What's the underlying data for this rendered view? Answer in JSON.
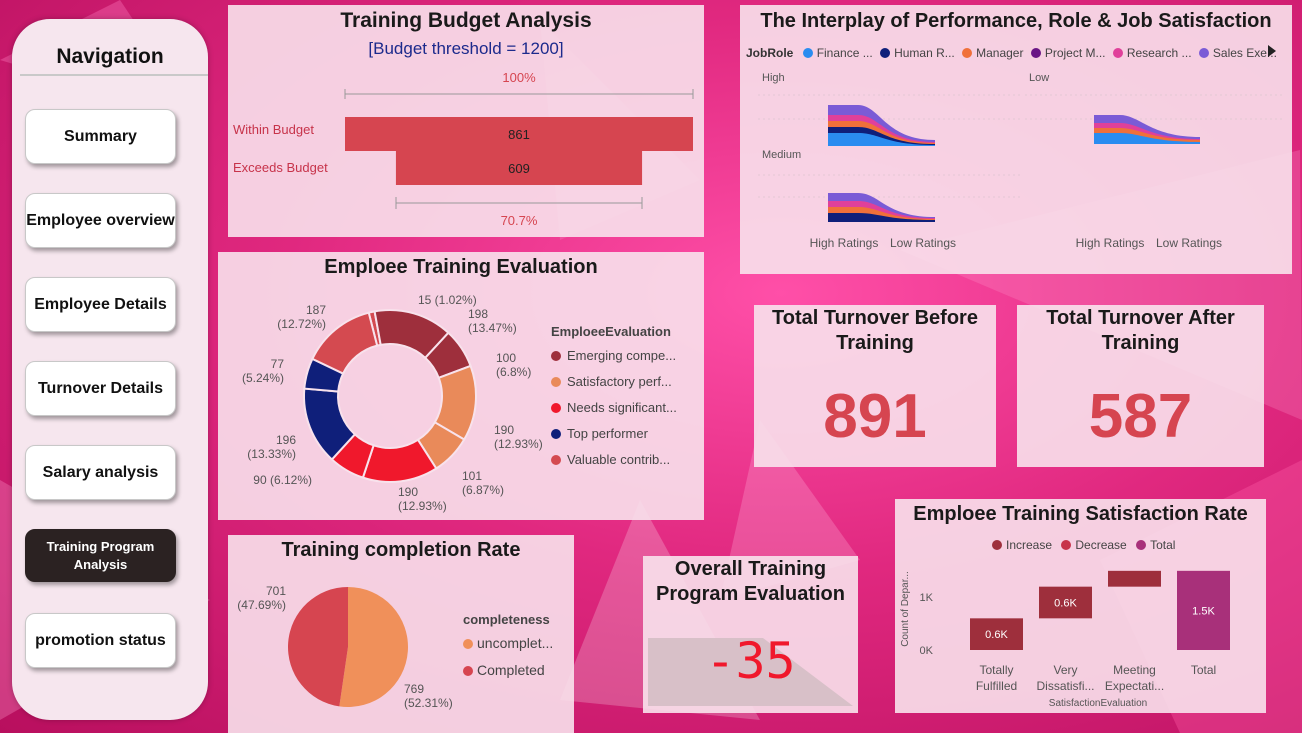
{
  "nav": {
    "title": "Navigation",
    "items": [
      {
        "label": "Summary",
        "active": false
      },
      {
        "label": "Employee overview",
        "active": false
      },
      {
        "label": "Employee Details",
        "active": false
      },
      {
        "label": "Turnover Details",
        "active": false
      },
      {
        "label": "Salary analysis",
        "active": false
      },
      {
        "label": "Training Program Analysis",
        "active": true
      },
      {
        "label": "promotion status",
        "active": false
      }
    ]
  },
  "budget": {
    "title": "Training Budget Analysis",
    "subtitle": "[Budget threshold = 1200]",
    "top_pct": "100%",
    "bottom_pct": "70.7%"
  },
  "interplay": {
    "title": "The Interplay of Performance, Role & Job Satisfaction",
    "legend_title": "JobRole",
    "legend": [
      {
        "label": "Finance ...",
        "color": "#2a8cf0"
      },
      {
        "label": "Human R...",
        "color": "#0f1f7a"
      },
      {
        "label": "Manager",
        "color": "#f0703a"
      },
      {
        "label": "Project M...",
        "color": "#6a1585"
      },
      {
        "label": "Research ...",
        "color": "#e0409a"
      },
      {
        "label": "Sales Exe...",
        "color": "#7a5bd6"
      }
    ],
    "panels": [
      "High",
      "Low",
      "Medium"
    ],
    "axis": [
      "High Ratings",
      "Low Ratings",
      "High Ratings",
      "Low Ratings"
    ]
  },
  "kpi_before": {
    "title": "Total Turnover Before Training",
    "value": "891"
  },
  "kpi_after": {
    "title": "Total Turnover After Training",
    "value": "587"
  },
  "overall": {
    "title": "Overall Training Program Evaluation",
    "value": "-35"
  },
  "evaluation": {
    "title": "Emploee Training Evaluation",
    "legend_title": "EmploeeEvaluation"
  },
  "completion": {
    "title": "Training completion Rate",
    "legend_title": "completeness"
  },
  "satisfaction": {
    "title": "Emploee Training Satisfaction Rate",
    "xlabel": "SatisfactionEvaluation",
    "ylabel": "Count of Depar...",
    "legend": [
      {
        "label": "Increase",
        "color": "#9e2f3c"
      },
      {
        "label": "Decrease",
        "color": "#c7334a"
      },
      {
        "label": "Total",
        "color": "#a8307a"
      }
    ]
  },
  "chart_data": [
    {
      "type": "bar",
      "orientation": "horizontal",
      "title": "Training Budget Analysis",
      "categories": [
        "Within Budget",
        "Exceeds Budget"
      ],
      "values": [
        861,
        609
      ],
      "color": "#d64550"
    },
    {
      "type": "pie",
      "donut": true,
      "title": "Emploee Training Evaluation",
      "legend_title": "EmploeeEvaluation",
      "legend": [
        "Emerging compe...",
        "Satisfactory perf...",
        "Needs significant...",
        "Top performer",
        "Valuable contrib..."
      ],
      "slices": [
        {
          "value": 15,
          "label": "15 (1.02%)",
          "color": "#d44a50"
        },
        {
          "value": 198,
          "label": "198 (13.47%)",
          "color": "#9e2f3c"
        },
        {
          "value": 100,
          "label": "100 (6.8%)",
          "color": "#9e2f3c"
        },
        {
          "value": 190,
          "label": "190 (12.93%)",
          "color": "#e98a5a"
        },
        {
          "value": 101,
          "label": "101 (6.87%)",
          "color": "#e98a5a"
        },
        {
          "value": 190,
          "label": "190 (12.93%)",
          "color": "#f0182c"
        },
        {
          "value": 90,
          "label": "90 (6.12%)",
          "color": "#f0182c"
        },
        {
          "value": 196,
          "label": "196 (13.33%)",
          "color": "#0f1f7a"
        },
        {
          "value": 77,
          "label": "77 (5.24%)",
          "color": "#0f1f7a"
        },
        {
          "value": 187,
          "label": "187 (12.72%)",
          "color": "#d44a50"
        }
      ]
    },
    {
      "type": "pie",
      "title": "Training completion Rate",
      "legend_title": "completeness",
      "slices": [
        {
          "name": "uncomplet...",
          "value": 769,
          "label": "769 (52.31%)",
          "color": "#f0905a"
        },
        {
          "name": "Completed",
          "value": 701,
          "label": "701 (47.69%)",
          "color": "#d64550"
        }
      ]
    },
    {
      "type": "bar",
      "subtype": "waterfall",
      "title": "Emploee Training Satisfaction Rate",
      "xlabel": "SatisfactionEvaluation",
      "ylabel": "Count of Depar...",
      "categories": [
        "Totally Fulfilled",
        "Very Dissatisfi...",
        "Meeting Expectati...",
        "Total"
      ],
      "steps": [
        {
          "start": 0,
          "end": 0.6,
          "label": "0.6K",
          "kind": "Increase"
        },
        {
          "start": 0.6,
          "end": 1.2,
          "label": "0.6K",
          "kind": "Increase"
        },
        {
          "start": 1.2,
          "end": 1.5,
          "label": "",
          "kind": "Increase"
        },
        {
          "start": 0,
          "end": 1.5,
          "label": "1.5K",
          "kind": "Total"
        }
      ],
      "unit": "K",
      "yticks": [
        "0K",
        "1K"
      ],
      "ylim": [
        0,
        1.8
      ]
    }
  ]
}
